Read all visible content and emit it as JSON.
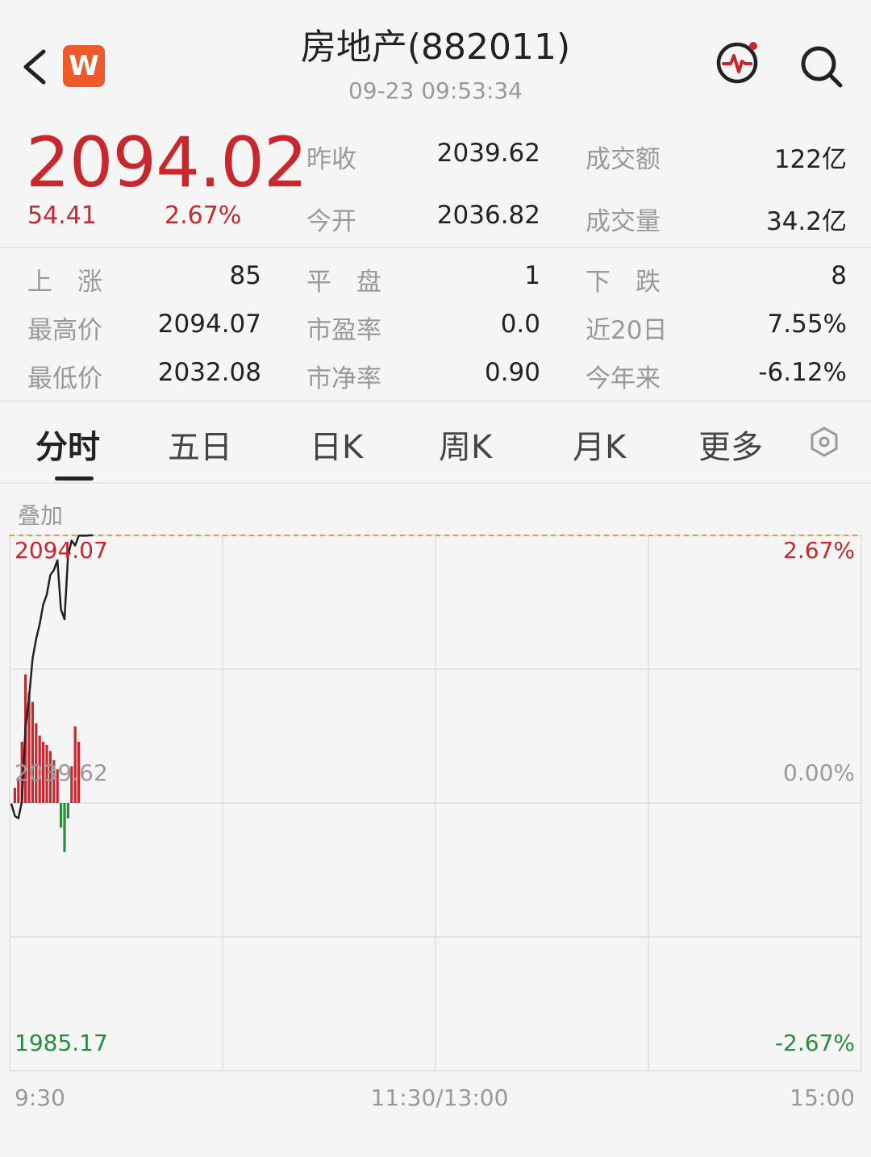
{
  "header": {
    "title": "房地产(882011)",
    "timestamp": "09-23 09:53:34",
    "logo_letter": "W",
    "icons": [
      "back-icon",
      "pulse-icon",
      "search-icon"
    ]
  },
  "quote": {
    "price": "2094.02",
    "change": "54.41",
    "change_pct": "2.67%",
    "prev_close_label": "昨收",
    "prev_close": "2039.62",
    "turnover_label": "成交额",
    "turnover": "122亿",
    "open_label": "今开",
    "open": "2036.82",
    "volume_label": "成交量",
    "volume": "34.2亿"
  },
  "stats": {
    "up_label": "上　涨",
    "up": "85",
    "flat_label": "平　盘",
    "flat": "1",
    "down_label": "下　跌",
    "down": "8",
    "high_label": "最高价",
    "high": "2094.07",
    "pe_label": "市盈率",
    "pe": "0.0",
    "d20_label": "近20日",
    "d20": "7.55%",
    "low_label": "最低价",
    "low": "2032.08",
    "pb_label": "市净率",
    "pb": "0.90",
    "ytd_label": "今年来",
    "ytd": "-6.12%"
  },
  "tabs": [
    {
      "label": "分时",
      "active": true
    },
    {
      "label": "五日"
    },
    {
      "label": "日K"
    },
    {
      "label": "周K"
    },
    {
      "label": "月K"
    },
    {
      "label": "更多"
    }
  ],
  "chart": {
    "overlay_label": "叠加",
    "y_max_label": "2094.07",
    "y_mid_label": "2039.62",
    "y_min_label": "1985.17",
    "pct_max": "2.67%",
    "pct_mid": "0.00%",
    "pct_min": "-2.67%",
    "x_start": "9:30",
    "x_mid": "11:30/13:00",
    "x_end": "15:00",
    "colors": {
      "up": "#c8282d",
      "down": "#2a8a3e",
      "line": "#222222"
    }
  },
  "chart_data": {
    "type": "line",
    "ylim": [
      1985.17,
      2094.07
    ],
    "prev_close": 2039.62,
    "x_minutes": [
      0,
      1,
      2,
      3,
      4,
      5,
      6,
      7,
      8,
      9,
      10,
      11,
      12,
      13,
      14,
      15,
      16,
      17,
      18,
      19,
      20,
      21,
      22,
      23
    ],
    "price": [
      2039.5,
      2037.0,
      2036.5,
      2040.0,
      2055.0,
      2061.0,
      2069.0,
      2073.0,
      2076.0,
      2080.0,
      2082.0,
      2086.0,
      2087.0,
      2089.0,
      2079.0,
      2077.0,
      2090.0,
      2093.0,
      2092.0,
      2094.0,
      2094.0,
      2094.0,
      2094.07,
      2094.07
    ],
    "bars": [
      {
        "x": 1,
        "v": 0.5
      },
      {
        "x": 2,
        "v": 0.8
      },
      {
        "x": 3,
        "v": 2.0
      },
      {
        "x": 4,
        "v": 4.2
      },
      {
        "x": 5,
        "v": 3.6
      },
      {
        "x": 6,
        "v": 3.3
      },
      {
        "x": 7,
        "v": 2.6
      },
      {
        "x": 8,
        "v": 2.2
      },
      {
        "x": 9,
        "v": 2.0
      },
      {
        "x": 10,
        "v": 1.9
      },
      {
        "x": 11,
        "v": 1.7
      },
      {
        "x": 12,
        "v": 1.4
      },
      {
        "x": 13,
        "v": 1.1
      },
      {
        "x": 14,
        "v": -0.8
      },
      {
        "x": 15,
        "v": -1.6
      },
      {
        "x": 16,
        "v": -0.5
      },
      {
        "x": 17,
        "v": 1.2
      },
      {
        "x": 18,
        "v": 2.5
      },
      {
        "x": 19,
        "v": 2.0
      }
    ]
  }
}
